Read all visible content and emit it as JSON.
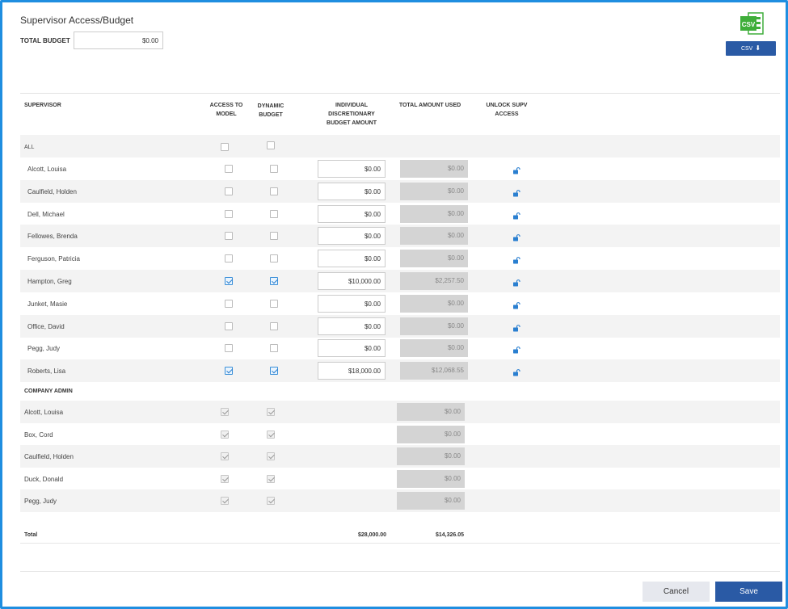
{
  "title": "Supervisor Access/Budget",
  "total_budget": {
    "label": "TOTAL BUDGET",
    "value": "$0.00"
  },
  "csv": {
    "icon_text": "CSV",
    "button_label": "CSV",
    "icon": "download-icon"
  },
  "columns": {
    "supervisor": "SUPERVISOR",
    "access": "ACCESS TO MODEL",
    "dynamic": "DYNAMIC BUDGET",
    "amount": "INDIVIDUAL DISCRETIONARY BUDGET AMOUNT",
    "used": "TOTAL AMOUNT USED",
    "unlock": "UNLOCK SUPV ACCESS"
  },
  "all_row": {
    "label": "ALL",
    "access": false,
    "dynamic": false
  },
  "supervisors": [
    {
      "name": "Alcott, Louisa",
      "access": false,
      "dynamic": false,
      "amount": "$0.00",
      "used": "$0.00"
    },
    {
      "name": "Caulfield, Holden",
      "access": false,
      "dynamic": false,
      "amount": "$0.00",
      "used": "$0.00"
    },
    {
      "name": "Dell, Michael",
      "access": false,
      "dynamic": false,
      "amount": "$0.00",
      "used": "$0.00"
    },
    {
      "name": "Fellowes, Brenda",
      "access": false,
      "dynamic": false,
      "amount": "$0.00",
      "used": "$0.00"
    },
    {
      "name": "Ferguson, Patricia",
      "access": false,
      "dynamic": false,
      "amount": "$0.00",
      "used": "$0.00"
    },
    {
      "name": "Hampton, Greg",
      "access": true,
      "dynamic": true,
      "amount": "$10,000.00",
      "used": "$2,257.50"
    },
    {
      "name": "Junket, Masie",
      "access": false,
      "dynamic": false,
      "amount": "$0.00",
      "used": "$0.00"
    },
    {
      "name": "Office, David",
      "access": false,
      "dynamic": false,
      "amount": "$0.00",
      "used": "$0.00"
    },
    {
      "name": "Pegg, Judy",
      "access": false,
      "dynamic": false,
      "amount": "$0.00",
      "used": "$0.00"
    },
    {
      "name": "Roberts, Lisa",
      "access": true,
      "dynamic": true,
      "amount": "$18,000.00",
      "used": "$12,068.55"
    }
  ],
  "company_admin_label": "COMPANY ADMIN",
  "admins": [
    {
      "name": "Alcott, Louisa",
      "used": "$0.00"
    },
    {
      "name": "Box, Cord",
      "used": "$0.00"
    },
    {
      "name": "Caulfield, Holden",
      "used": "$0.00"
    },
    {
      "name": "Duck, Donald",
      "used": "$0.00"
    },
    {
      "name": "Pegg, Judy",
      "used": "$0.00"
    }
  ],
  "total": {
    "label": "Total",
    "amount": "$28,000.00",
    "used": "$14,326.05"
  },
  "buttons": {
    "cancel": "Cancel",
    "save": "Save"
  },
  "colors": {
    "accent": "#2a5aa5",
    "frame": "#1f8ee0",
    "csv_green": "#3fae3a"
  }
}
